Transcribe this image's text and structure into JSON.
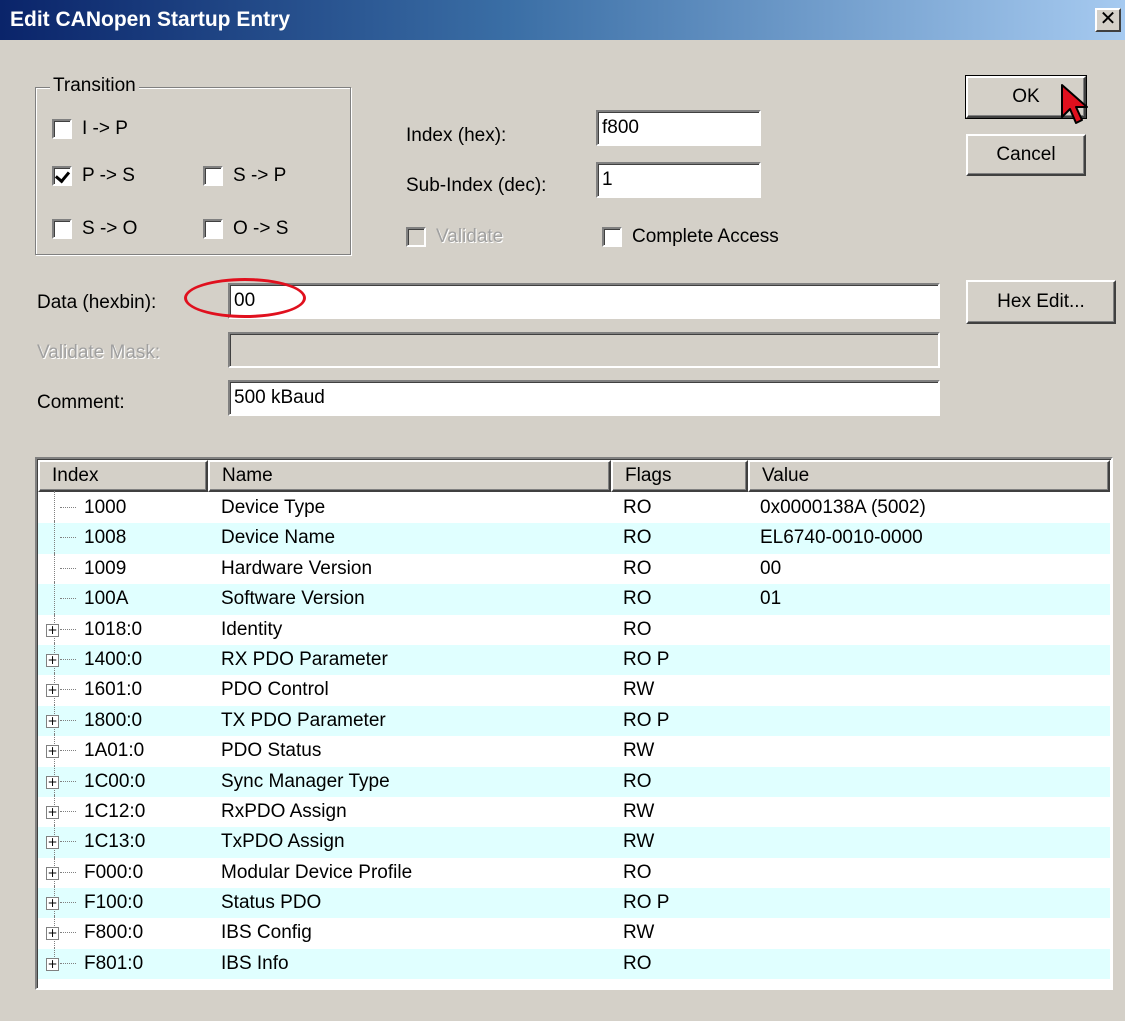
{
  "window": {
    "title": "Edit CANopen Startup Entry",
    "close_glyph": "✕"
  },
  "transition": {
    "label": "Transition",
    "items": [
      {
        "label": "I -> P",
        "checked": false
      },
      {
        "label": "P -> S",
        "checked": true
      },
      {
        "label": "S -> P",
        "checked": false
      },
      {
        "label": "S -> O",
        "checked": false
      },
      {
        "label": "O -> S",
        "checked": false
      }
    ]
  },
  "index": {
    "label": "Index (hex):",
    "value": "f800"
  },
  "subindex": {
    "label": "Sub-Index (dec):",
    "value": "1"
  },
  "validate": {
    "label": "Validate",
    "checked": false,
    "enabled": false
  },
  "complete_access": {
    "label": "Complete Access",
    "checked": false
  },
  "data": {
    "label": "Data (hexbin):",
    "value": "00"
  },
  "validate_mask": {
    "label": "Validate Mask:",
    "value": ""
  },
  "comment": {
    "label": "Comment:",
    "value": "500 kBaud"
  },
  "buttons": {
    "ok": "OK",
    "cancel": "Cancel",
    "hex_edit": "Hex Edit..."
  },
  "table": {
    "columns": [
      "Index",
      "Name",
      "Flags",
      "Value"
    ],
    "rows": [
      {
        "index": "1000",
        "name": "Device Type",
        "flags": "RO",
        "value": "0x0000138A (5002)",
        "expandable": false
      },
      {
        "index": "1008",
        "name": "Device Name",
        "flags": "RO",
        "value": "EL6740-0010-0000",
        "expandable": false
      },
      {
        "index": "1009",
        "name": "Hardware Version",
        "flags": "RO",
        "value": "00",
        "expandable": false
      },
      {
        "index": "100A",
        "name": "Software Version",
        "flags": "RO",
        "value": "01",
        "expandable": false
      },
      {
        "index": "1018:0",
        "name": "Identity",
        "flags": "RO",
        "value": "",
        "expandable": true
      },
      {
        "index": "1400:0",
        "name": "RX PDO Parameter",
        "flags": "RO P",
        "value": "",
        "expandable": true
      },
      {
        "index": "1601:0",
        "name": "PDO Control",
        "flags": "RW",
        "value": "",
        "expandable": true
      },
      {
        "index": "1800:0",
        "name": "TX PDO Parameter",
        "flags": "RO P",
        "value": "",
        "expandable": true
      },
      {
        "index": "1A01:0",
        "name": "PDO Status",
        "flags": "RW",
        "value": "",
        "expandable": true
      },
      {
        "index": "1C00:0",
        "name": "Sync Manager Type",
        "flags": "RO",
        "value": "",
        "expandable": true
      },
      {
        "index": "1C12:0",
        "name": "RxPDO Assign",
        "flags": "RW",
        "value": "",
        "expandable": true
      },
      {
        "index": "1C13:0",
        "name": "TxPDO Assign",
        "flags": "RW",
        "value": "",
        "expandable": true
      },
      {
        "index": "F000:0",
        "name": "Modular Device Profile",
        "flags": "RO",
        "value": "",
        "expandable": true
      },
      {
        "index": "F100:0",
        "name": "Status PDO",
        "flags": "RO P",
        "value": "",
        "expandable": true
      },
      {
        "index": "F800:0",
        "name": "IBS Config",
        "flags": "RW",
        "value": "",
        "expandable": true
      },
      {
        "index": "F801:0",
        "name": "IBS Info",
        "flags": "RO",
        "value": "",
        "expandable": true
      }
    ]
  },
  "colors": {
    "highlight_row": "#e0ffff",
    "annotation": "#e0101e",
    "titlebar_start": "#0a246a"
  },
  "icons": {
    "cursor": "arrow-cursor-icon",
    "close": "close-icon"
  }
}
